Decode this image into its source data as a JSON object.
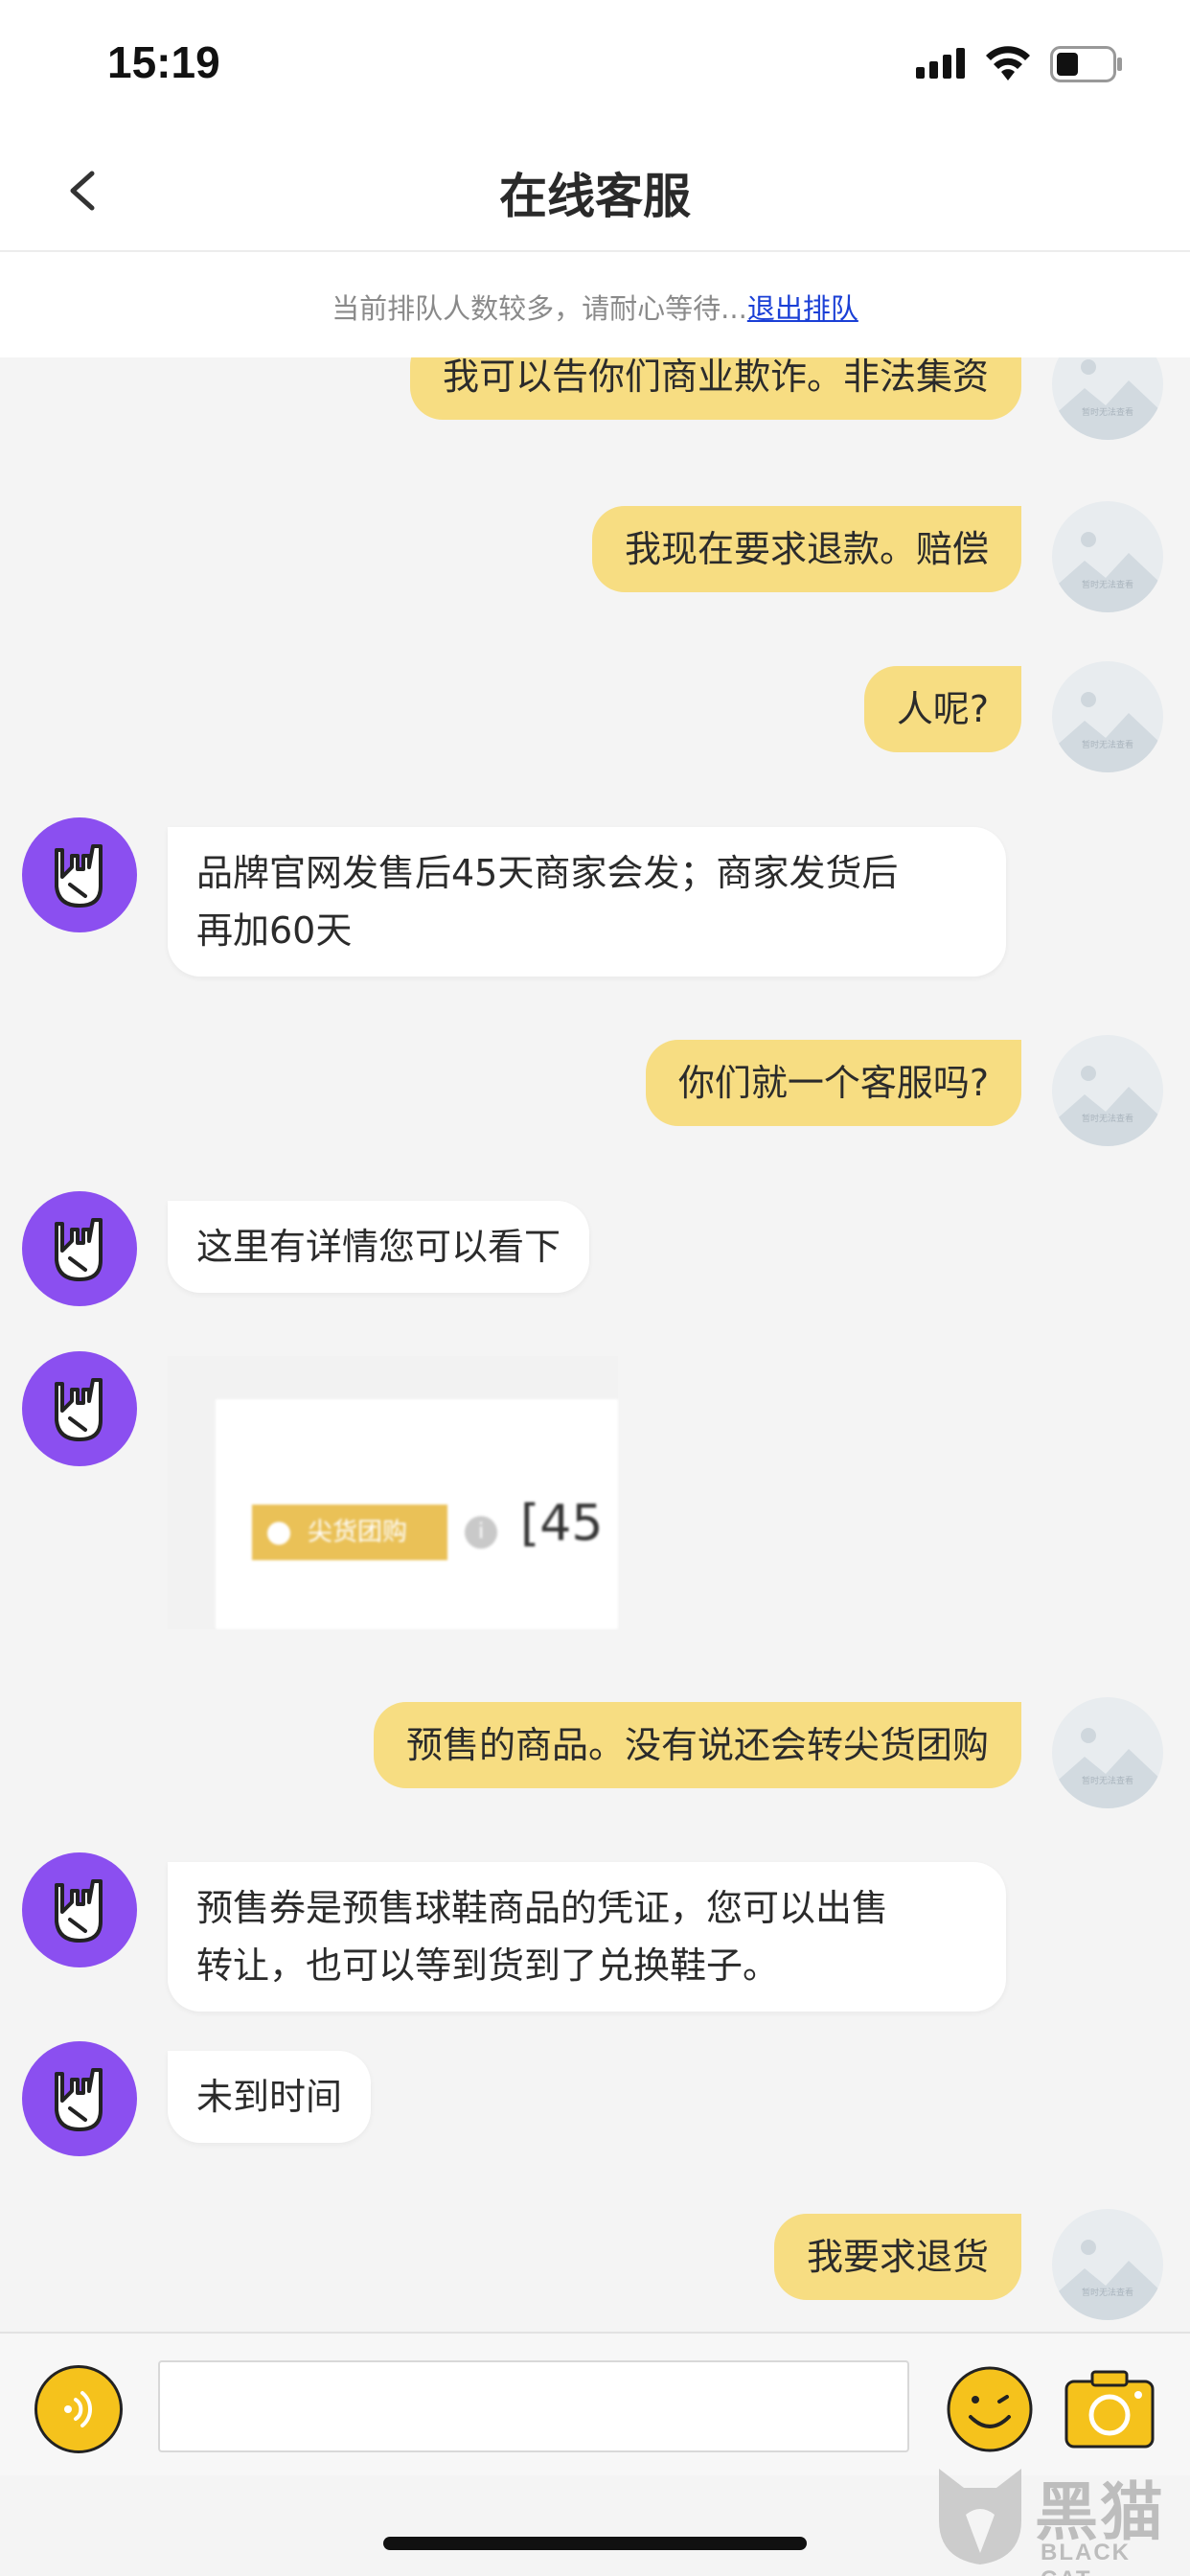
{
  "status_bar": {
    "time": "15:19"
  },
  "nav": {
    "title": "在线客服"
  },
  "queue": {
    "notice": "当前排队人数较多，请耐心等待...",
    "exit_label": "退出排队"
  },
  "avatar_placeholder_text": "暂时无法查看",
  "messages": [
    {
      "from": "user",
      "text": "我可以告你们商业欺诈。非法集资"
    },
    {
      "from": "user",
      "text": "我现在要求退款。赔偿"
    },
    {
      "from": "user",
      "text": "人呢?"
    },
    {
      "from": "agent",
      "lines": [
        "品牌官网发售后45天商家会发；商家发货后",
        "再加60天"
      ]
    },
    {
      "from": "user",
      "text": "你们就一个客服吗?"
    },
    {
      "from": "agent",
      "text": "这里有详情您可以看下"
    },
    {
      "from": "agent",
      "type": "image",
      "tag": "尖货团购",
      "price": "[45"
    },
    {
      "from": "user",
      "text": "预售的商品。没有说还会转尖货团购"
    },
    {
      "from": "agent",
      "lines": [
        "预售券是预售球鞋商品的凭证，您可以出售",
        "转让，也可以等到货到了兑换鞋子。"
      ]
    },
    {
      "from": "agent",
      "text": "未到时间"
    },
    {
      "from": "user",
      "text": "我要求退货"
    }
  ],
  "input": {
    "placeholder": "",
    "value": ""
  },
  "watermark": {
    "cn": "黑猫",
    "en": "BLACK CAT"
  },
  "colors": {
    "user_bubble": "#f7dd82",
    "agent_bubble": "#ffffff",
    "agent_avatar": "#8b4ff0",
    "link": "#1a3fd6",
    "accent": "#f5c21c"
  }
}
